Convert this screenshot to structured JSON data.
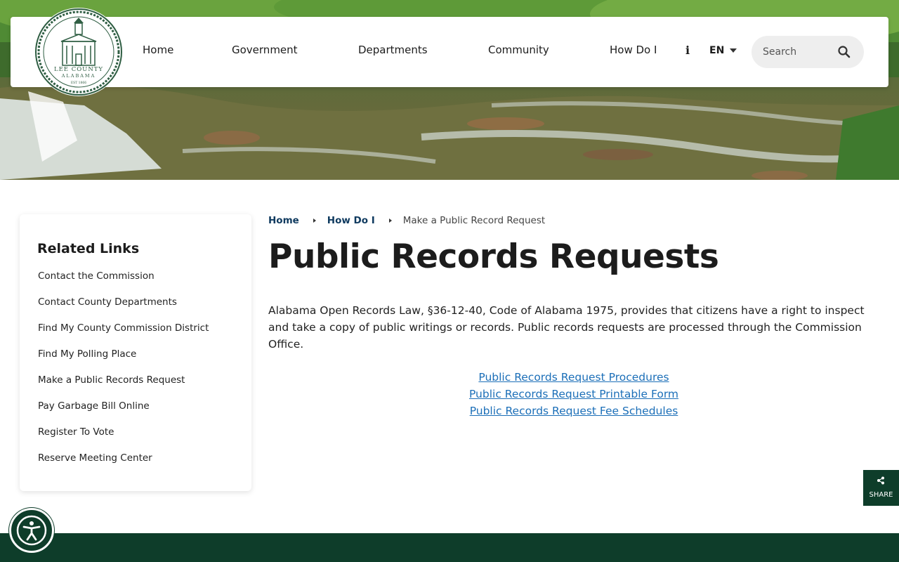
{
  "header": {
    "logo_text": {
      "top": "LEE COUNTY",
      "middle": "ALABAMA",
      "bottom": "EST 1866"
    },
    "nav": [
      {
        "label": "Home"
      },
      {
        "label": "Government"
      },
      {
        "label": "Departments"
      },
      {
        "label": "Community"
      },
      {
        "label": "How Do I"
      }
    ],
    "info_glyph": "i",
    "language": "EN",
    "search": {
      "placeholder": "Search"
    }
  },
  "sidebar": {
    "title": "Related Links",
    "links": [
      {
        "label": "Contact the Commission"
      },
      {
        "label": "Contact County Departments"
      },
      {
        "label": "Find My County Commission District"
      },
      {
        "label": "Find My Polling Place"
      },
      {
        "label": "Make a Public Records Request"
      },
      {
        "label": "Pay Garbage Bill Online"
      },
      {
        "label": "Register To Vote"
      },
      {
        "label": "Reserve Meeting Center"
      }
    ]
  },
  "breadcrumb": {
    "home": "Home",
    "parent": "How Do I",
    "current": "Make a Public Record Request"
  },
  "main": {
    "title": "Public Records Requests",
    "intro": "Alabama Open Records Law, §36-12-40, Code of Alabama 1975, provides that citizens have a right to inspect and take a copy of public writings or records.  Public records requests are processed through the Commission Office.",
    "documents": [
      {
        "label": "Public Records Request Procedures"
      },
      {
        "label": "Public Records Request Printable Form"
      },
      {
        "label": "Public Records Request Fee Schedules"
      }
    ]
  },
  "share": {
    "label": "SHARE"
  },
  "colors": {
    "brand_green": "#0e3d2a",
    "link_blue": "#1c6fb8",
    "breadcrumb_blue": "#0f3a5f"
  },
  "icons": {
    "search": "magnifier-icon",
    "share": "share-icon",
    "accessibility": "accessibility-icon",
    "info": "info-icon",
    "language_caret": "caret-down-icon"
  }
}
